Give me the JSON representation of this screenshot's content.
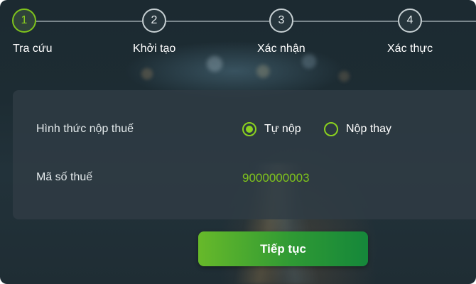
{
  "stepper": {
    "steps": [
      {
        "number": "1",
        "label": "Tra cứu",
        "active": true
      },
      {
        "number": "2",
        "label": "Khởi tạo",
        "active": false
      },
      {
        "number": "3",
        "label": "Xác nhận",
        "active": false
      },
      {
        "number": "4",
        "label": "Xác thực",
        "active": false
      }
    ]
  },
  "form": {
    "payment_method": {
      "label": "Hình thức nộp thuế",
      "options": [
        {
          "label": "Tự nộp",
          "selected": true
        },
        {
          "label": "Nộp thay",
          "selected": false
        }
      ]
    },
    "tax_code": {
      "label": "Mã số thuế",
      "value": "9000000003"
    }
  },
  "actions": {
    "continue_label": "Tiếp tục"
  },
  "colors": {
    "accent": "#8bd11f",
    "button_start": "#67b92a",
    "button_end": "#15873a"
  }
}
